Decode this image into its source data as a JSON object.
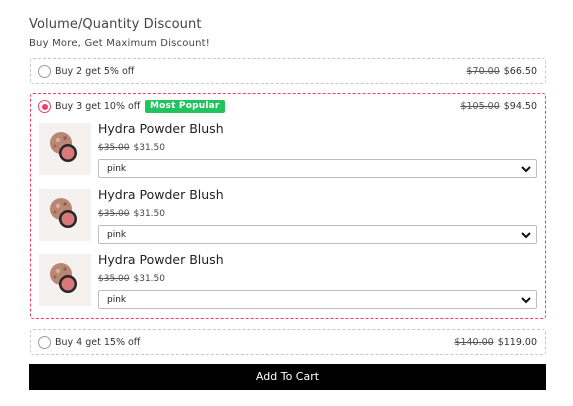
{
  "header": {
    "title": "Volume/Quantity Discount",
    "subtitle": "Buy More, Get Maximum Discount!"
  },
  "options": [
    {
      "label": "Buy 2 get 5% off",
      "old_price": "$70.00",
      "new_price": "$66.50",
      "selected": false
    },
    {
      "label": "Buy 3 get 10% off",
      "badge": "Most Popular",
      "old_price": "$105.00",
      "new_price": "$94.50",
      "selected": true
    },
    {
      "label": "Buy 4 get 15% off",
      "old_price": "$140.00",
      "new_price": "$119.00",
      "selected": false
    }
  ],
  "items": [
    {
      "name": "Hydra Powder Blush",
      "old_price": "$35.00",
      "new_price": "$31.50",
      "variant": "pink"
    },
    {
      "name": "Hydra Powder Blush",
      "old_price": "$35.00",
      "new_price": "$31.50",
      "variant": "pink"
    },
    {
      "name": "Hydra Powder Blush",
      "old_price": "$35.00",
      "new_price": "$31.50",
      "variant": "pink"
    }
  ],
  "cart": {
    "label": "Add To Cart"
  },
  "colors": {
    "accent": "#ee3f67",
    "badge": "#22c35e",
    "button": "#000000"
  },
  "icons": {
    "select_arrow": "chevron-down-icon",
    "radio": "radio-icon",
    "thumbnail": "blush-compact-image"
  }
}
